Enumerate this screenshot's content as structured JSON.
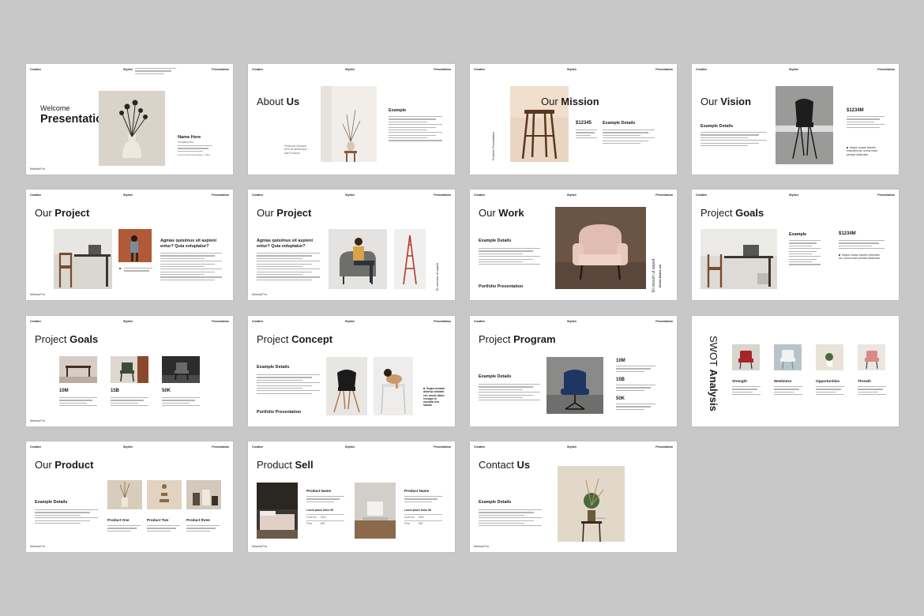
{
  "header": {
    "left": "Creative",
    "center": "Stylish",
    "right": "Presentation"
  },
  "footer": "Minimal Pro",
  "slides": {
    "s1": {
      "welcome": "Welcome",
      "presentation": "Presentation",
      "name": "Name Here",
      "company": "Company Info",
      "caption": "Lorem Presente Design - 2024"
    },
    "s2": {
      "t1": "About",
      "t2": "Us",
      "example": "Example",
      "quote": "Porta quis sit ipsum elit in at ullamcorper ante in lacinia"
    },
    "s3": {
      "t1": "Our",
      "t2": "Mission",
      "number": "$12345",
      "details": "Example Details",
      "vertical": "Portfolio Presentation"
    },
    "s4": {
      "t1": "Our",
      "t2": "Vision",
      "details": "Example Details",
      "number": "$1234M",
      "bullet": "Neque mosse lobortis extended est, omnis mare perindo distinctive"
    },
    "s5": {
      "t1": "Our",
      "t2": "Project",
      "heading": "Agnias quisimus sit aspieni entur? Quia voluptatur?"
    },
    "s6": {
      "t1": "Our",
      "t2": "Project",
      "heading": "Agnias quisimus sit aspieni entur? Quia voluptatur?",
      "vertical": "Et osectum ut aspieit"
    },
    "s7": {
      "t1": "Our",
      "t2": "Work",
      "details": "Example Details",
      "portfolio": "Portfolio Presentation",
      "vertical": "Et ossoim ut aspeit",
      "vertical2": "Emilio Makes um"
    },
    "s8": {
      "t1": "Project",
      "t2": "Goals",
      "example": "Example",
      "number": "$1234M",
      "bullet": "Neque mosse lobortis extended est, omnis mare perindo distinctive"
    },
    "s9": {
      "t1": "Project",
      "t2": "Goals",
      "stats": [
        {
          "value": "10M"
        },
        {
          "value": "15B"
        },
        {
          "value": "50K"
        }
      ]
    },
    "s10": {
      "t1": "Project",
      "t2": "Concept",
      "details": "Example Details",
      "portfolio": "Portfolio Presentation",
      "bullet": "Sogus mosam dolorep uteclant est, omnis daelo recodpe in movalia erro lobode"
    },
    "s11": {
      "t1": "Project",
      "t2": "Program",
      "details": "Example Details",
      "stats": [
        {
          "value": "10M"
        },
        {
          "value": "15B"
        },
        {
          "value": "50K"
        }
      ]
    },
    "s12": {
      "t1": "SWOT",
      "t2": "Analysis",
      "items": [
        {
          "label": "Strength"
        },
        {
          "label": "Weekness"
        },
        {
          "label": "Opportunities"
        },
        {
          "label": "Threath"
        }
      ]
    },
    "s13": {
      "t1": "Our",
      "t2": "Product",
      "details": "Example Details",
      "products": [
        {
          "label": "Product One"
        },
        {
          "label": "Product Two"
        },
        {
          "label": "Product three"
        }
      ]
    },
    "s14": {
      "t1": "Product",
      "t2": "Sell",
      "products": [
        {
          "name": "Product Name",
          "sub": "Lorem Ipsum Dolor Sit",
          "code_label": "Code No.",
          "code": "0001",
          "price_label": "Price",
          "price": "$25"
        },
        {
          "name": "Product Name",
          "sub": "Lorem Ipsum Dolor Sit",
          "code_label": "Code No.",
          "code": "0001",
          "price_label": "Price",
          "price": "$25"
        }
      ]
    },
    "s15": {
      "t1": "Contact",
      "t2": "Us",
      "details": "Example Details",
      "caption": "Lorem Ipsum"
    }
  },
  "colors": {
    "background": "#c8c8c8",
    "slide": "#ffffff",
    "text": "#1b1b1b"
  }
}
